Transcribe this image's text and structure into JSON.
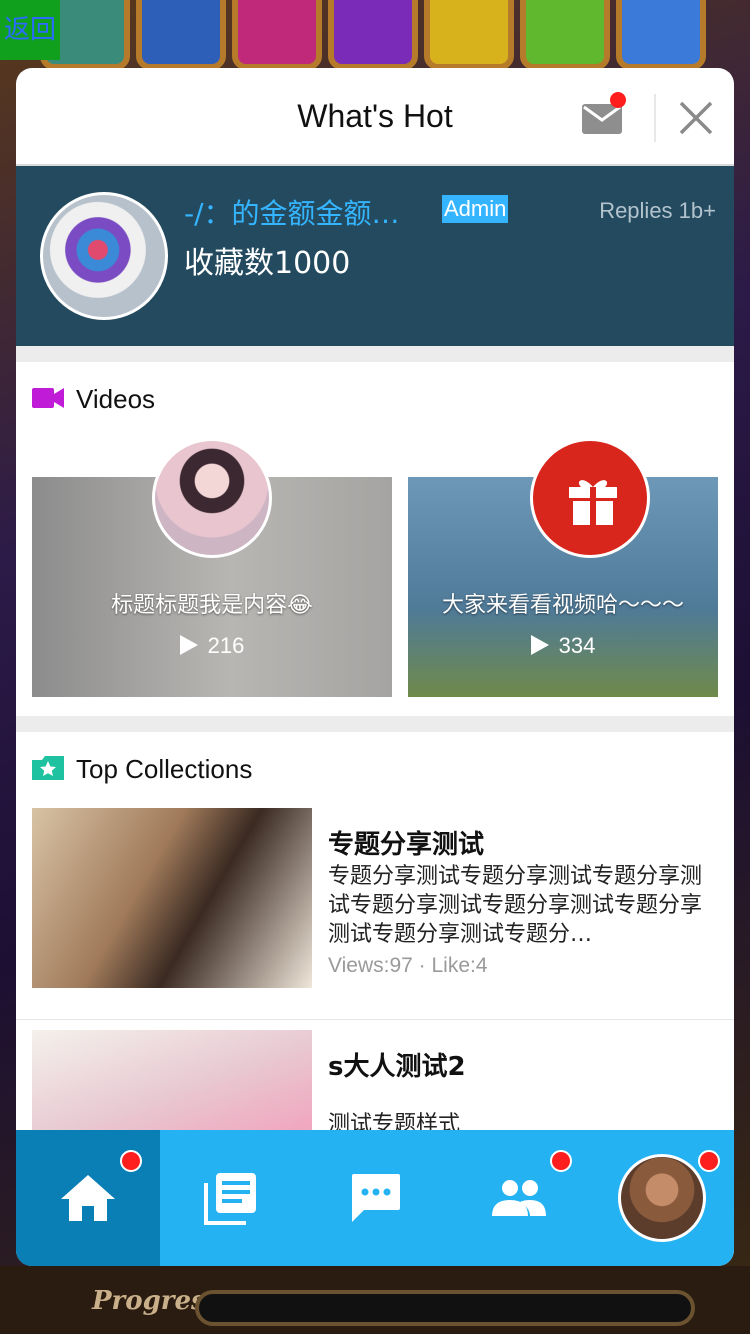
{
  "back_label": "返回",
  "background": {
    "progress_text": "Progress"
  },
  "header": {
    "title": "What's Hot"
  },
  "banner": {
    "name": "-/：的金额金额…",
    "badge": "Admin",
    "replies": "Replies 1b+",
    "subtitle": "收藏数1000"
  },
  "videos": {
    "section_title": "Videos",
    "items": [
      {
        "title": "标题标题我是内容😂",
        "plays": "216"
      },
      {
        "title": "大家来看看视频哈～～～",
        "plays": "334"
      }
    ]
  },
  "collections": {
    "section_title": "Top Collections",
    "items": [
      {
        "title": "专题分享测试",
        "description": "专题分享测试专题分享测试专题分享测试专题分享测试专题分享测试专题分享测试专题分享测试专题分…",
        "meta": "Views:97 · Like:4"
      },
      {
        "title": "s大人测试2",
        "description": "测试专题样式",
        "meta": ""
      }
    ]
  },
  "colors": {
    "accent": "#24b2f3",
    "accent_dark": "#0a7fb5",
    "banner_bg": "#234a5f",
    "badge": "#35b4ff",
    "notification": "#ff1e1e",
    "video_icon": "#c01cd8",
    "collection_icon": "#1fc2a0"
  },
  "tabbar": {
    "tabs": [
      {
        "icon": "home-icon",
        "active": true,
        "badge": true
      },
      {
        "icon": "articles-icon",
        "active": false,
        "badge": false
      },
      {
        "icon": "chat-icon",
        "active": false,
        "badge": false
      },
      {
        "icon": "people-icon",
        "active": false,
        "badge": true
      },
      {
        "icon": "profile-avatar",
        "active": false,
        "badge": true
      }
    ]
  }
}
